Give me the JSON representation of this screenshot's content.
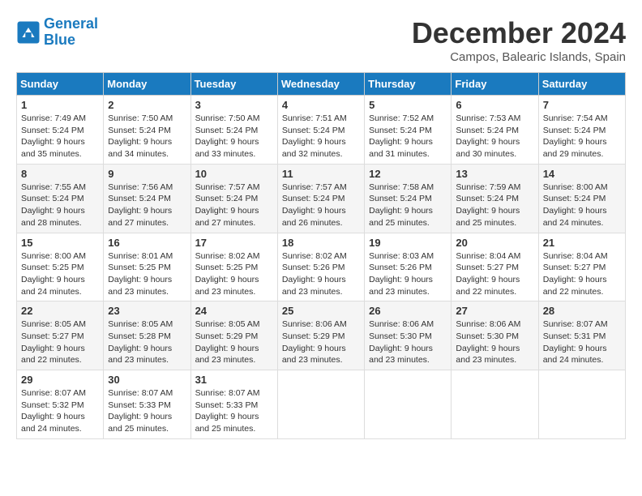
{
  "logo": {
    "line1": "General",
    "line2": "Blue"
  },
  "title": "December 2024",
  "location": "Campos, Balearic Islands, Spain",
  "weekdays": [
    "Sunday",
    "Monday",
    "Tuesday",
    "Wednesday",
    "Thursday",
    "Friday",
    "Saturday"
  ],
  "weeks": [
    [
      {
        "day": "1",
        "sunrise": "7:49 AM",
        "sunset": "5:24 PM",
        "daylight": "9 hours and 35 minutes."
      },
      {
        "day": "2",
        "sunrise": "7:50 AM",
        "sunset": "5:24 PM",
        "daylight": "9 hours and 34 minutes."
      },
      {
        "day": "3",
        "sunrise": "7:50 AM",
        "sunset": "5:24 PM",
        "daylight": "9 hours and 33 minutes."
      },
      {
        "day": "4",
        "sunrise": "7:51 AM",
        "sunset": "5:24 PM",
        "daylight": "9 hours and 32 minutes."
      },
      {
        "day": "5",
        "sunrise": "7:52 AM",
        "sunset": "5:24 PM",
        "daylight": "9 hours and 31 minutes."
      },
      {
        "day": "6",
        "sunrise": "7:53 AM",
        "sunset": "5:24 PM",
        "daylight": "9 hours and 30 minutes."
      },
      {
        "day": "7",
        "sunrise": "7:54 AM",
        "sunset": "5:24 PM",
        "daylight": "9 hours and 29 minutes."
      }
    ],
    [
      {
        "day": "8",
        "sunrise": "7:55 AM",
        "sunset": "5:24 PM",
        "daylight": "9 hours and 28 minutes."
      },
      {
        "day": "9",
        "sunrise": "7:56 AM",
        "sunset": "5:24 PM",
        "daylight": "9 hours and 27 minutes."
      },
      {
        "day": "10",
        "sunrise": "7:57 AM",
        "sunset": "5:24 PM",
        "daylight": "9 hours and 27 minutes."
      },
      {
        "day": "11",
        "sunrise": "7:57 AM",
        "sunset": "5:24 PM",
        "daylight": "9 hours and 26 minutes."
      },
      {
        "day": "12",
        "sunrise": "7:58 AM",
        "sunset": "5:24 PM",
        "daylight": "9 hours and 25 minutes."
      },
      {
        "day": "13",
        "sunrise": "7:59 AM",
        "sunset": "5:24 PM",
        "daylight": "9 hours and 25 minutes."
      },
      {
        "day": "14",
        "sunrise": "8:00 AM",
        "sunset": "5:24 PM",
        "daylight": "9 hours and 24 minutes."
      }
    ],
    [
      {
        "day": "15",
        "sunrise": "8:00 AM",
        "sunset": "5:25 PM",
        "daylight": "9 hours and 24 minutes."
      },
      {
        "day": "16",
        "sunrise": "8:01 AM",
        "sunset": "5:25 PM",
        "daylight": "9 hours and 23 minutes."
      },
      {
        "day": "17",
        "sunrise": "8:02 AM",
        "sunset": "5:25 PM",
        "daylight": "9 hours and 23 minutes."
      },
      {
        "day": "18",
        "sunrise": "8:02 AM",
        "sunset": "5:26 PM",
        "daylight": "9 hours and 23 minutes."
      },
      {
        "day": "19",
        "sunrise": "8:03 AM",
        "sunset": "5:26 PM",
        "daylight": "9 hours and 23 minutes."
      },
      {
        "day": "20",
        "sunrise": "8:04 AM",
        "sunset": "5:27 PM",
        "daylight": "9 hours and 22 minutes."
      },
      {
        "day": "21",
        "sunrise": "8:04 AM",
        "sunset": "5:27 PM",
        "daylight": "9 hours and 22 minutes."
      }
    ],
    [
      {
        "day": "22",
        "sunrise": "8:05 AM",
        "sunset": "5:27 PM",
        "daylight": "9 hours and 22 minutes."
      },
      {
        "day": "23",
        "sunrise": "8:05 AM",
        "sunset": "5:28 PM",
        "daylight": "9 hours and 23 minutes."
      },
      {
        "day": "24",
        "sunrise": "8:05 AM",
        "sunset": "5:29 PM",
        "daylight": "9 hours and 23 minutes."
      },
      {
        "day": "25",
        "sunrise": "8:06 AM",
        "sunset": "5:29 PM",
        "daylight": "9 hours and 23 minutes."
      },
      {
        "day": "26",
        "sunrise": "8:06 AM",
        "sunset": "5:30 PM",
        "daylight": "9 hours and 23 minutes."
      },
      {
        "day": "27",
        "sunrise": "8:06 AM",
        "sunset": "5:30 PM",
        "daylight": "9 hours and 23 minutes."
      },
      {
        "day": "28",
        "sunrise": "8:07 AM",
        "sunset": "5:31 PM",
        "daylight": "9 hours and 24 minutes."
      }
    ],
    [
      {
        "day": "29",
        "sunrise": "8:07 AM",
        "sunset": "5:32 PM",
        "daylight": "9 hours and 24 minutes."
      },
      {
        "day": "30",
        "sunrise": "8:07 AM",
        "sunset": "5:33 PM",
        "daylight": "9 hours and 25 minutes."
      },
      {
        "day": "31",
        "sunrise": "8:07 AM",
        "sunset": "5:33 PM",
        "daylight": "9 hours and 25 minutes."
      },
      null,
      null,
      null,
      null
    ]
  ]
}
